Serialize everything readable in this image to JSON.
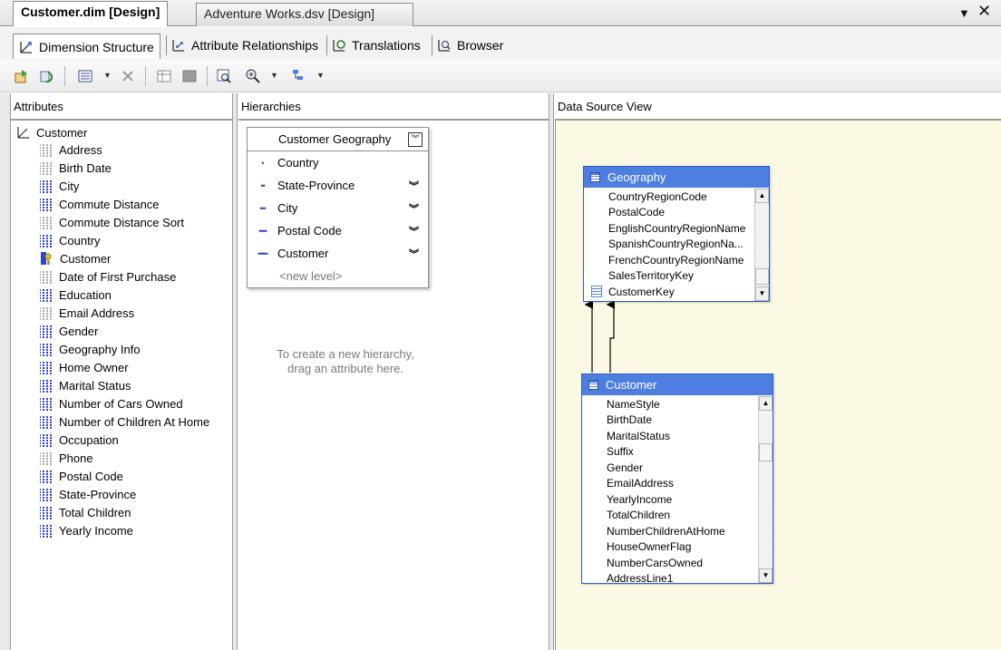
{
  "doc_tabs": {
    "active": "Customer.dim [Design]",
    "inactive": "Adventure Works.dsv [Design]",
    "dropdown_icon": "chevron-down-icon",
    "close_icon": "close-icon"
  },
  "designer_tabs": [
    {
      "label": "Dimension Structure",
      "icon": "dimension-structure-icon"
    },
    {
      "label": "Attribute Relationships",
      "icon": "attribute-relationships-icon"
    },
    {
      "label": "Translations",
      "icon": "translations-icon"
    },
    {
      "label": "Browser",
      "icon": "browser-icon"
    }
  ],
  "toolbar": {
    "icons": [
      "process-icon",
      "refresh-icon",
      "show-attribute-types-icon",
      "delete-icon",
      "show-table-icon",
      "hide-table-icon",
      "find-table-icon",
      "zoom-icon",
      "arrange-tables-icon"
    ]
  },
  "attributes": {
    "header": "Attributes",
    "root": "Customer",
    "items": [
      {
        "label": "Address",
        "icon": "gray"
      },
      {
        "label": "Birth Date",
        "icon": "gray"
      },
      {
        "label": "City",
        "icon": "blue"
      },
      {
        "label": "Commute Distance",
        "icon": "blue"
      },
      {
        "label": "Commute Distance Sort",
        "icon": "gray"
      },
      {
        "label": "Country",
        "icon": "blue"
      },
      {
        "label": "Customer",
        "icon": "key"
      },
      {
        "label": "Date of First Purchase",
        "icon": "gray"
      },
      {
        "label": "Education",
        "icon": "blue"
      },
      {
        "label": "Email Address",
        "icon": "gray"
      },
      {
        "label": "Gender",
        "icon": "blue"
      },
      {
        "label": "Geography Info",
        "icon": "blue"
      },
      {
        "label": "Home Owner",
        "icon": "blue"
      },
      {
        "label": "Marital Status",
        "icon": "blue"
      },
      {
        "label": "Number of Cars Owned",
        "icon": "blue"
      },
      {
        "label": "Number of Children At Home",
        "icon": "blue"
      },
      {
        "label": "Occupation",
        "icon": "blue"
      },
      {
        "label": "Phone",
        "icon": "gray"
      },
      {
        "label": "Postal Code",
        "icon": "blue"
      },
      {
        "label": "State-Province",
        "icon": "blue"
      },
      {
        "label": "Total Children",
        "icon": "blue"
      },
      {
        "label": "Yearly Income",
        "icon": "blue"
      }
    ]
  },
  "hierarchies": {
    "header": "Hierarchies",
    "hierarchy_name": "Customer Geography",
    "levels": [
      {
        "label": "Country",
        "dots": "•"
      },
      {
        "label": "State-Province",
        "dots": "••"
      },
      {
        "label": "City",
        "dots": "•••"
      },
      {
        "label": "Postal Code",
        "dots": "••••"
      },
      {
        "label": "Customer",
        "dots": "•••••"
      }
    ],
    "new_level": "<new level>",
    "hint_line1": "To create a new hierarchy,",
    "hint_line2": "drag an attribute here."
  },
  "dsv": {
    "header": "Data Source View",
    "geography": {
      "title": "Geography",
      "columns": [
        "CountryRegionCode",
        "PostalCode",
        "EnglishCountryRegionName",
        "SpanishCountryRegionNa...",
        "FrenchCountryRegionName",
        "SalesTerritoryKey",
        "CustomerKey"
      ]
    },
    "customer": {
      "title": "Customer",
      "columns": [
        "NameStyle",
        "BirthDate",
        "MaritalStatus",
        "Suffix",
        "Gender",
        "EmailAddress",
        "YearlyIncome",
        "TotalChildren",
        "NumberChildrenAtHome",
        "HouseOwnerFlag",
        "NumberCarsOwned",
        "AddressLine1"
      ]
    }
  },
  "colors": {
    "table_title_bg": "#4e7fe0",
    "dsv_canvas_bg": "#fbf9e3",
    "attribute_blue": "#2f45c4"
  }
}
